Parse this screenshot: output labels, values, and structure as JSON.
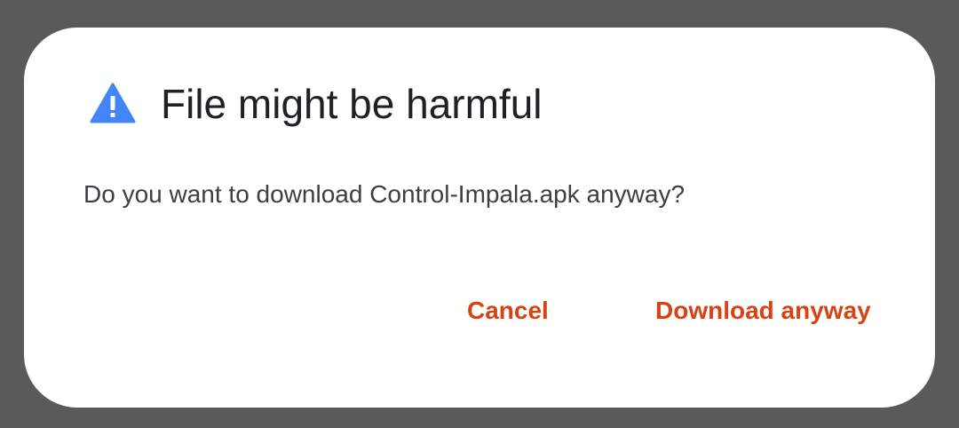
{
  "dialog": {
    "icon": "warning-triangle-icon",
    "icon_color": "#4285f4",
    "title": "File might be harmful",
    "message": "Do you want to download Control-Impala.apk anyway?",
    "buttons": {
      "cancel_label": "Cancel",
      "download_label": "Download anyway"
    },
    "button_color": "#d84315"
  }
}
